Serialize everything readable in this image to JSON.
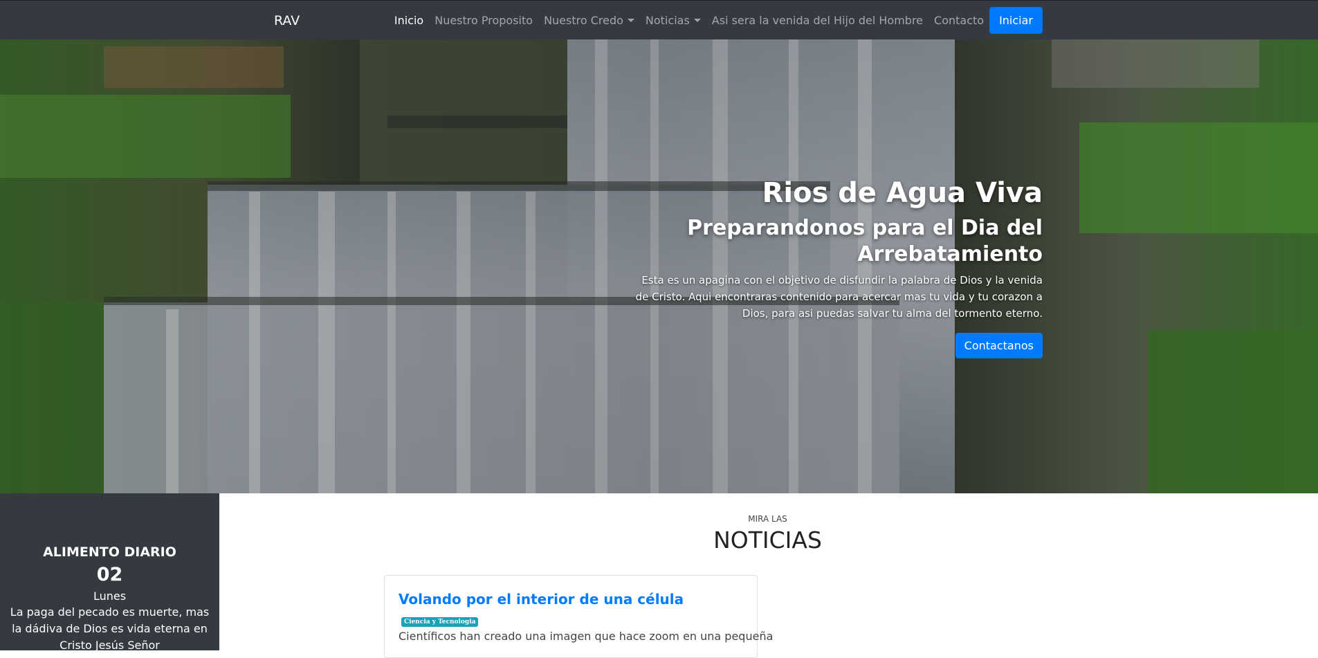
{
  "navbar": {
    "brand": "RAV",
    "items": [
      {
        "label": "Inicio",
        "active": true,
        "dropdown": false
      },
      {
        "label": "Nuestro Proposito",
        "active": false,
        "dropdown": false
      },
      {
        "label": "Nuestro Credo",
        "active": false,
        "dropdown": true
      },
      {
        "label": "Noticias",
        "active": false,
        "dropdown": true
      },
      {
        "label": "Asi sera la venida del Hijo del Hombre",
        "active": false,
        "dropdown": false
      },
      {
        "label": "Contacto",
        "active": false,
        "dropdown": false
      }
    ],
    "login_label": "Iniciar"
  },
  "hero": {
    "title": "Rios de Agua Viva",
    "subtitle": "Preparandonos para el Dia del Arrebatamiento",
    "description": "Esta es un apagina con el objetivo de disfundir la palabra de Dios y la venida de Cristo. Aqui encontraras contenido para acercar mas tu vida y tu corazon a Dios, para asi puedas salvar tu alma del tormento eterno.",
    "button_label": "Contactanos"
  },
  "daily": {
    "title": "ALIMENTO DIARIO",
    "day": "02",
    "weekday": "Lunes",
    "verse": "La paga del pecado es muerte, mas la dádiva de Dios es vida eterna en Cristo Jesús Señor"
  },
  "news": {
    "kicker": "MIRA LAS",
    "heading": "NOTICIAS",
    "cards": [
      {
        "title": "Volando por el interior de una célula",
        "tag": "Ciencia y Tecnologia",
        "excerpt": "Científicos han creado una imagen que hace zoom en una pequeña"
      }
    ]
  },
  "colors": {
    "navbar_bg": "#343a40",
    "primary": "#007bff",
    "badge": "#17a2b8",
    "sidebar_bg": "#343a40"
  }
}
